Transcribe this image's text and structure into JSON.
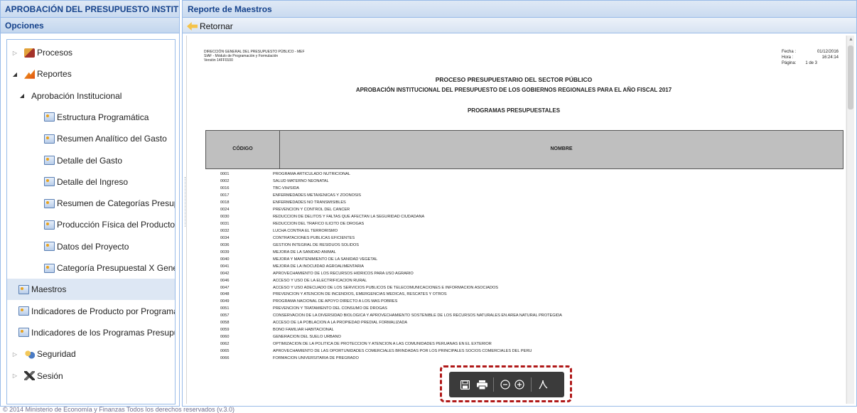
{
  "left": {
    "app_title": "APROBACIÓN DEL PRESUPUESTO INSTITUCIONAL",
    "options_title": "Opciones",
    "tree": [
      {
        "label": "Procesos",
        "level": 0,
        "icon": "procesos-icon",
        "expanded": false
      },
      {
        "label": "Reportes",
        "level": 0,
        "icon": "reportes-icon",
        "expanded": true
      },
      {
        "label": "Aprobación Institucional",
        "level": 1,
        "icon": "",
        "expanded": true
      },
      {
        "label": "Estructura Programática",
        "level": 2,
        "icon": "report-icon"
      },
      {
        "label": "Resumen Analítico del Gasto",
        "level": 2,
        "icon": "report-icon"
      },
      {
        "label": "Detalle del Gasto",
        "level": 2,
        "icon": "report-icon"
      },
      {
        "label": "Detalle del Ingreso",
        "level": 2,
        "icon": "report-icon"
      },
      {
        "label": "Resumen de Categorías Presupuestales",
        "level": 2,
        "icon": "report-icon"
      },
      {
        "label": "Producción Física del Producto",
        "level": 2,
        "icon": "report-icon"
      },
      {
        "label": "Datos del Proyecto",
        "level": 2,
        "icon": "report-icon"
      },
      {
        "label": "Categoría Presupuestal X Generica",
        "level": 2,
        "icon": "report-icon"
      },
      {
        "label": "Maestros",
        "level": 1,
        "icon": "report-icon",
        "selected": true
      },
      {
        "label": "Indicadores de Producto por Programa",
        "level": 1,
        "icon": "report-icon"
      },
      {
        "label": "Indicadores de los Programas Presupuestales",
        "level": 1,
        "icon": "report-icon"
      },
      {
        "label": "Seguridad",
        "level": 0,
        "icon": "seguridad-icon",
        "expanded": false
      },
      {
        "label": "Sesión",
        "level": 0,
        "icon": "sesion-icon",
        "expanded": false
      }
    ]
  },
  "right": {
    "title": "Reporte de Maestros",
    "back_label": "Retornar"
  },
  "report": {
    "org_lines": [
      "DIRECCIÓN GENERAL DEL PRESUPUESTO PÚBLICO - MEF",
      "SIAF - Módulo de Programación y Formulación",
      "Versión 14FF0100"
    ],
    "fecha_label": "Fecha :",
    "fecha": "01/12/2016",
    "hora_label": "Hora :",
    "hora": "16:24:14",
    "pagina_label": "Página:",
    "pagina": "1 de 3",
    "title1": "PROCESO PRESUPUESTARIO DEL SECTOR PÚBLICO",
    "title2": "APROBACIÓN INSTITUCIONAL DEL PRESUPUESTO DE LOS GOBIERNOS REGIONALES PARA EL AÑO FISCAL 2017",
    "section": "PROGRAMAS PRESUPUESTALES",
    "col_code": "CÓDIGO",
    "col_name": "NOMBRE",
    "rows": [
      [
        "0001",
        "PROGRAMA ARTICULADO NUTRICIONAL"
      ],
      [
        "0002",
        "SALUD MATERNO NEONATAL"
      ],
      [
        "0016",
        "TBC-VIH/SIDA"
      ],
      [
        "0017",
        "ENFERMEDADES METAXENICAS Y ZOONOSIS"
      ],
      [
        "0018",
        "ENFERMEDADES NO TRANSMISIBLES"
      ],
      [
        "0024",
        "PREVENCION Y CONTROL DEL CANCER"
      ],
      [
        "0030",
        "REDUCCION DE DELITOS Y FALTAS QUE AFECTAN LA SEGURIDAD CIUDADANA"
      ],
      [
        "0031",
        "REDUCCION DEL TRAFICO ILICITO DE DROGAS"
      ],
      [
        "0032",
        "LUCHA CONTRA EL TERRORISMO"
      ],
      [
        "0034",
        "CONTRATACIONES PUBLICAS EFICIENTES"
      ],
      [
        "0036",
        "GESTION INTEGRAL DE RESIDUOS SOLIDOS"
      ],
      [
        "0039",
        "MEJORA DE LA SANIDAD ANIMAL"
      ],
      [
        "0040",
        "MEJORA Y MANTENIMIENTO DE LA SANIDAD VEGETAL"
      ],
      [
        "0041",
        "MEJORA DE LA INOCUIDAD AGROALIMENTARIA"
      ],
      [
        "0042",
        "APROVECHAMIENTO DE LOS RECURSOS HIDRICOS PARA USO AGRARIO"
      ],
      [
        "0046",
        "ACCESO Y USO DE LA ELECTRIFICACION RURAL"
      ],
      [
        "0047",
        "ACCESO Y USO ADECUADO DE LOS SERVICIOS PUBLICOS DE TELECOMUNICACIONES E INFORMACION ASOCIADOS"
      ],
      [
        "0048",
        "PREVENCION Y ATENCION DE INCENDIOS, EMERGENCIAS MEDICAS, RESCATES Y OTROS"
      ],
      [
        "0049",
        "PROGRAMA NACIONAL DE APOYO DIRECTO A LOS MAS POBRES"
      ],
      [
        "0051",
        "PREVENCION Y TRATAMIENTO DEL CONSUMO DE DROGAS"
      ],
      [
        "0057",
        "CONSERVACION DE LA DIVERSIDAD BIOLOGICA Y APROVECHAMIENTO SOSTENIBLE DE LOS RECURSOS NATURALES EN AREA NATURAL PROTEGIDA"
      ],
      [
        "0058",
        "ACCESO DE LA POBLACION A LA PROPIEDAD PREDIAL FORMALIZADA"
      ],
      [
        "0059",
        "BONO FAMILIAR HABITACIONAL"
      ],
      [
        "0060",
        "GENERACION DEL SUELO URBANO"
      ],
      [
        "0062",
        "OPTIMIZACION DE LA POLITICA DE PROTECCION Y ATENCION A LAS COMUNIDADES PERUANAS EN EL EXTERIOR"
      ],
      [
        "0065",
        "APROVECHAMIENTO DE LAS OPORTUNIDADES COMERCIALES BRINDADAS POR LOS PRINCIPALES SOCIOS COMERCIALES DEL PERU"
      ],
      [
        "0066",
        "FORMACION UNIVERSITARIA DE PREGRADO"
      ]
    ]
  },
  "pdf_toolbar": {
    "buttons": [
      "save-icon",
      "print-icon",
      "zoom-out-icon",
      "zoom-in-icon",
      "acrobat-icon"
    ],
    "highlight_color": "#b01818"
  },
  "footer": "© 2014 Ministerio de Economía y Finanzas Todos los derechos reservados (v.3.0)",
  "colors": {
    "header_text": "#15428b",
    "border": "#99bbe8",
    "selected": "#dde7f4"
  }
}
